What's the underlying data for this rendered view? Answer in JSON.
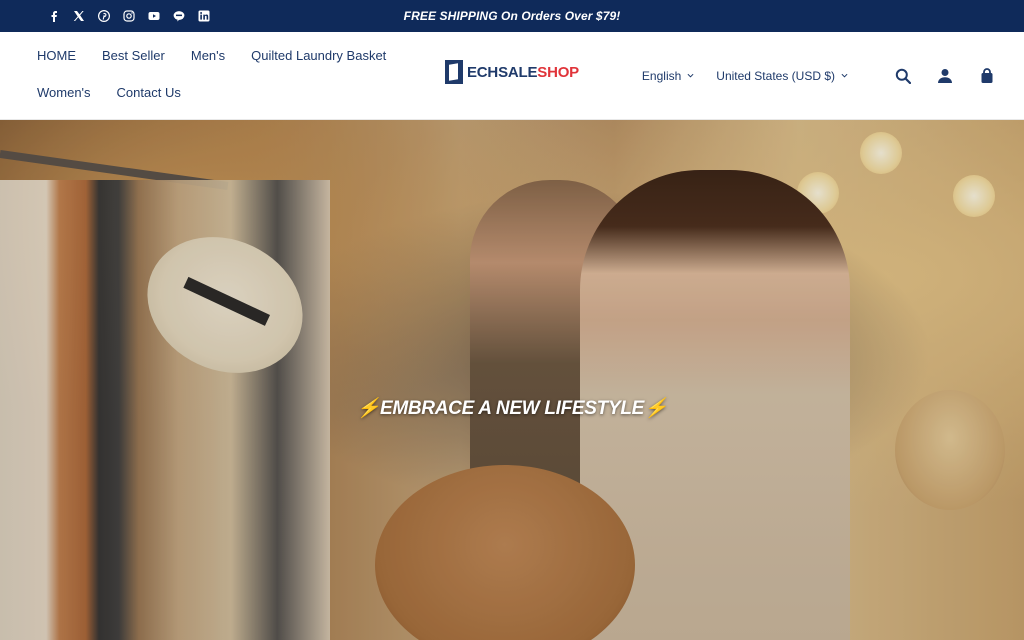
{
  "topbar": {
    "announcement": "FREE SHIPPING On Orders Over $79!",
    "socials": [
      {
        "icon": "facebook-icon",
        "glyph": "f"
      },
      {
        "icon": "x-twitter-icon",
        "glyph": "𝕏"
      },
      {
        "icon": "pinterest-icon",
        "glyph": "P"
      },
      {
        "icon": "instagram-icon",
        "glyph": ""
      },
      {
        "icon": "youtube-icon",
        "glyph": ""
      },
      {
        "icon": "line-icon",
        "glyph": ""
      },
      {
        "icon": "linkedin-icon",
        "glyph": "in"
      }
    ],
    "bg_color": "#0f2a5a"
  },
  "nav": {
    "row1": [
      "HOME",
      "Best Seller",
      "Men's",
      "Quilted Laundry Basket"
    ],
    "row2": [
      "Women's",
      "Contact Us"
    ]
  },
  "logo": {
    "part1": "ECHSALE",
    "part2": "SHOP"
  },
  "utilities": {
    "language": "English",
    "country": "United States (USD $)",
    "icons": [
      "search-icon",
      "account-icon",
      "cart-icon"
    ]
  },
  "hero": {
    "tagline": "⚡EMBRACE A NEW LIFESTYLE⚡"
  }
}
